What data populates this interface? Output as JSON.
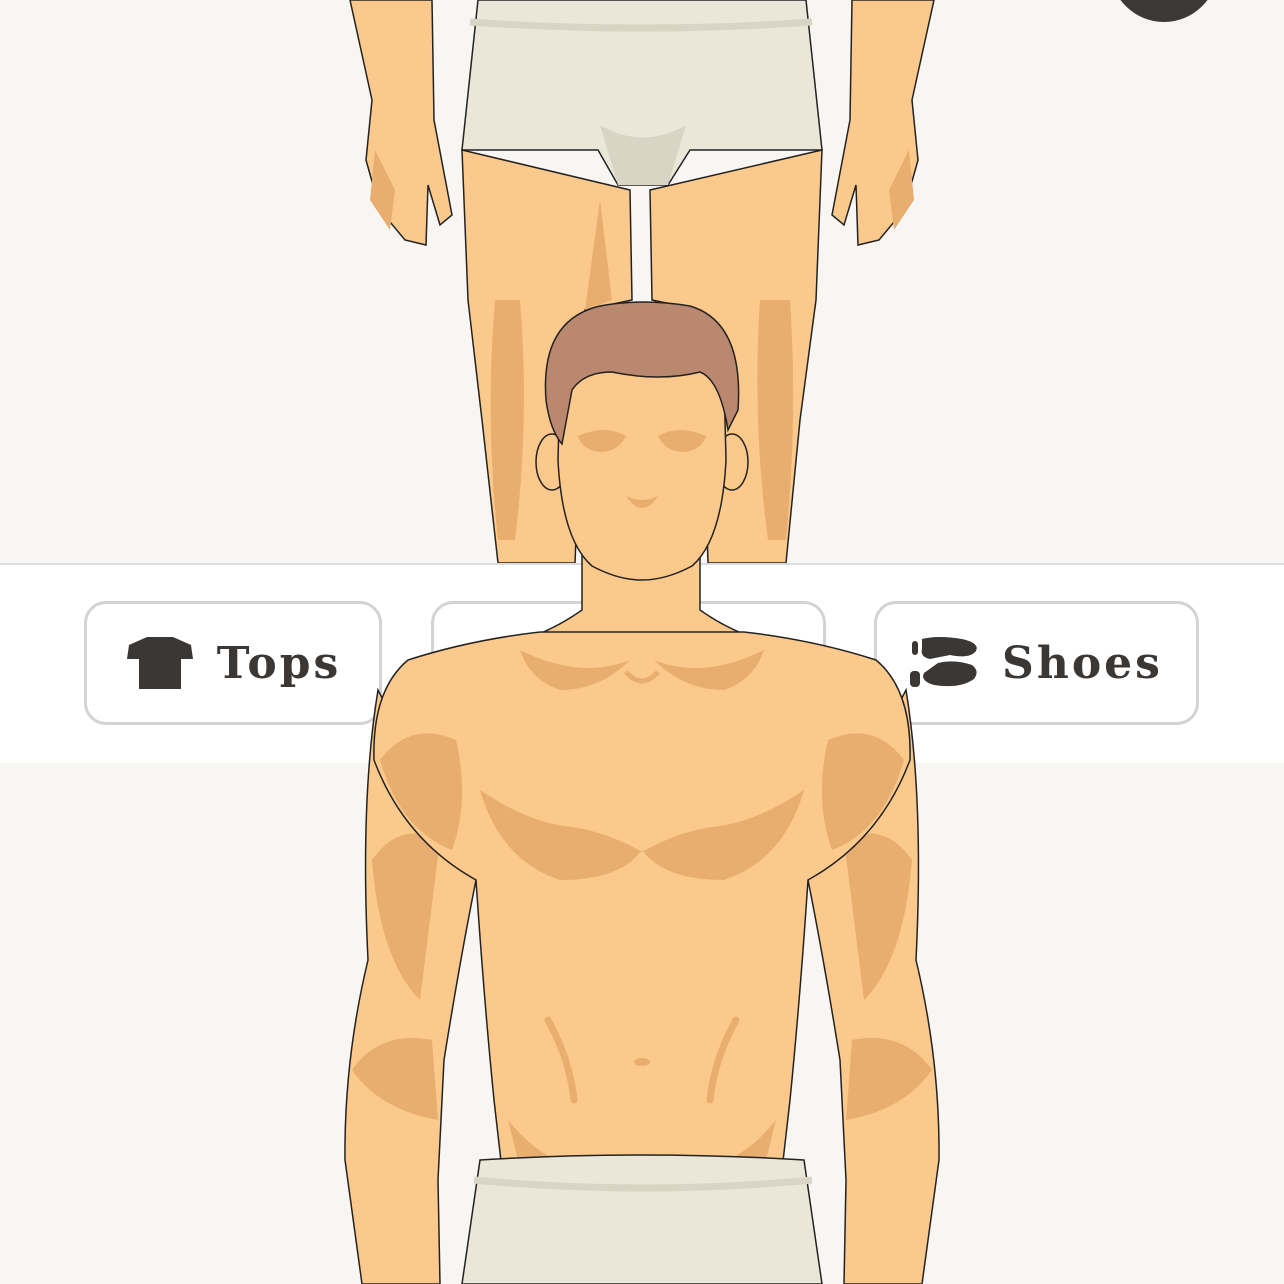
{
  "toolbar": {
    "tops_label": "Tops",
    "bottoms_label": "",
    "shoes_label": "Shoes"
  },
  "icons": {
    "tops": "tshirt-icon",
    "shoes": "footprints-icon",
    "corner": "menu-icon"
  },
  "colors": {
    "skin": "#fbc98c",
    "skin_shade": "#e8ae70",
    "hair": "#b9886f",
    "underwear": "#ebe7d8",
    "underwear_shade": "#d9d5c4",
    "text": "#3a3735",
    "background": "#f7f6f3"
  }
}
